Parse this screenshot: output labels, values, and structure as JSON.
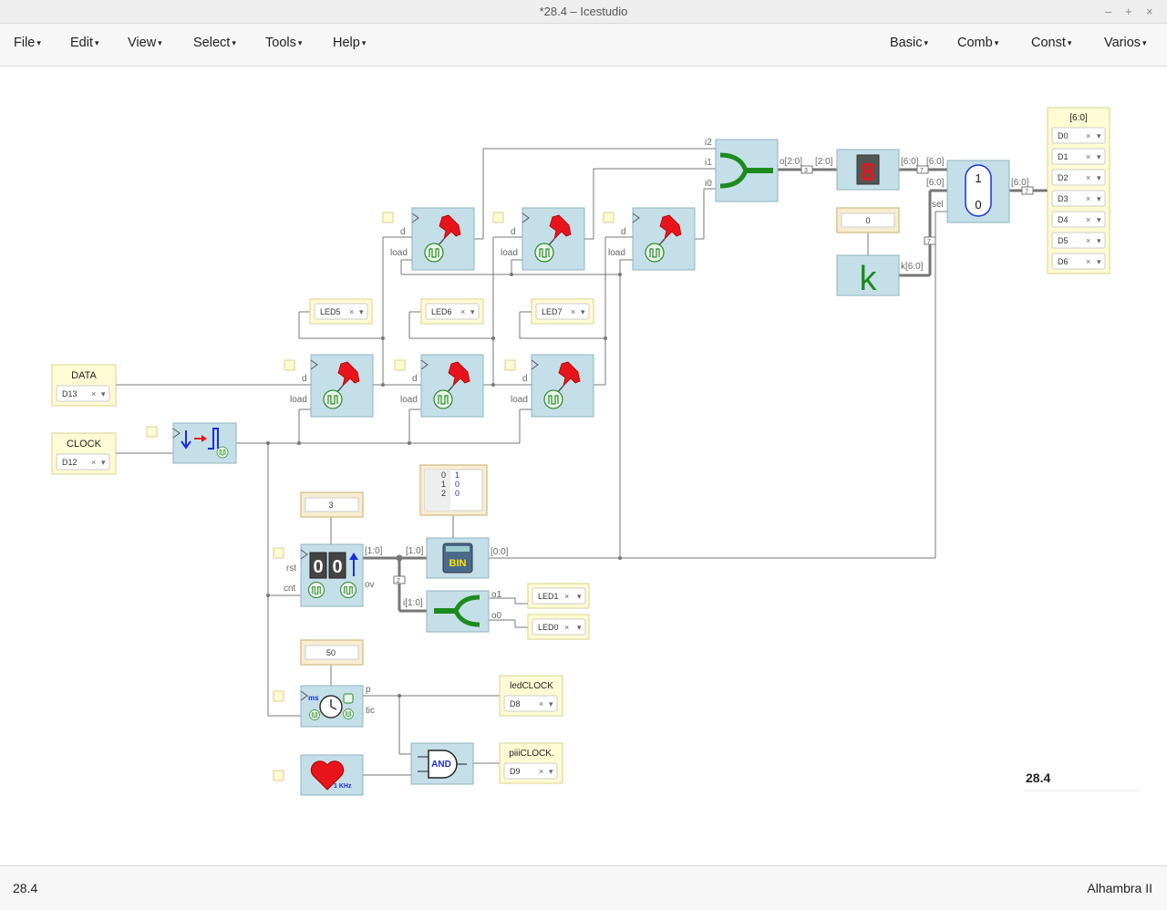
{
  "window": {
    "title": "*28.4 – Icestudio",
    "controls": [
      "–",
      "+",
      "×"
    ]
  },
  "menu_left": [
    {
      "label": "File"
    },
    {
      "label": "Edit"
    },
    {
      "label": "View"
    },
    {
      "label": "Select"
    },
    {
      "label": "Tools"
    },
    {
      "label": "Help"
    }
  ],
  "menu_right": [
    {
      "label": "Basic"
    },
    {
      "label": "Comb"
    },
    {
      "label": "Const"
    },
    {
      "label": "Varios"
    }
  ],
  "status": {
    "left": "28.4",
    "right": "Alhambra II"
  },
  "canvas": {
    "design_name": "28.4",
    "inputs": {
      "data": {
        "name": "DATA",
        "pin": "D13"
      },
      "clock": {
        "name": "CLOCK",
        "pin": "D12"
      }
    },
    "outputs": {
      "led5": "LED5",
      "led6": "LED6",
      "led7": "LED7",
      "led1": "LED1",
      "led0": "LED0",
      "ledclock": {
        "name": "ledCLOCK",
        "pin": "D8"
      },
      "piiiclock": {
        "name": "piiiCLOCK.",
        "pin": "D9"
      },
      "bus_out": {
        "name": "[6:0]",
        "pins": [
          "D0",
          "D1",
          "D2",
          "D3",
          "D4",
          "D5",
          "D6"
        ]
      }
    },
    "constants": {
      "counter": "3",
      "timer": "50",
      "k_value": "0"
    },
    "table": {
      "rows": [
        [
          "0",
          "1"
        ],
        [
          "1",
          "0"
        ],
        [
          "2",
          "0"
        ]
      ]
    },
    "labels": {
      "i2": "i2",
      "i1": "i1",
      "i0": "i0",
      "o_bus": "o[2:0]",
      "bus_in": "[2:0]",
      "seg_out": "[6:0]",
      "mux_in": "[6:0]",
      "mux_in2": "[6:0]",
      "mux_out": "[6:0]",
      "sel": "sel",
      "k_bus": "k[6:0]",
      "k_letter": "k",
      "cnt_bus": "[1:0]",
      "bin_in": "[1:0]",
      "bin_out": "[0:0]",
      "split_in": "i[1:0]",
      "o1": "o1",
      "o0": "o0",
      "p": "p",
      "tic": "tic",
      "rst": "rst",
      "cnt": "cnt",
      "ov": "ov",
      "d": "d",
      "load": "load",
      "ms": "ms",
      "khz": "1 KHz",
      "and": "AND",
      "bin": "BIN",
      "mux_1": "1",
      "mux_0": "0",
      "w3": "3",
      "w7": "7",
      "w2": "2"
    }
  }
}
